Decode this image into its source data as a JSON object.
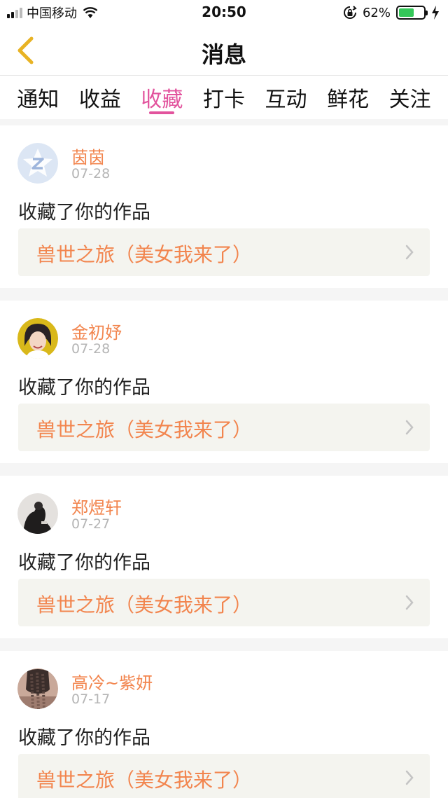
{
  "status_bar": {
    "carrier": "中国移动",
    "time": "20:50",
    "battery_percent": "62%",
    "battery_level": 0.62,
    "icons": [
      "signal-icon",
      "wifi-icon",
      "rotation-lock-icon",
      "battery-icon",
      "charging-icon"
    ]
  },
  "nav": {
    "title": "消息",
    "back_icon": "chevron-left-icon"
  },
  "tabs": [
    {
      "label": "通知",
      "active": false
    },
    {
      "label": "收益",
      "active": false
    },
    {
      "label": "收藏",
      "active": true
    },
    {
      "label": "打卡",
      "active": false
    },
    {
      "label": "互动",
      "active": false
    },
    {
      "label": "鲜花",
      "active": false
    },
    {
      "label": "关注",
      "active": false
    }
  ],
  "messages": [
    {
      "user": "茵茵",
      "date": "07-28",
      "text": "收藏了你的作品",
      "work": "兽世之旅（美女我来了）",
      "avatar": "default-avatar"
    },
    {
      "user": "金初妤",
      "date": "07-28",
      "text": "收藏了你的作品",
      "work": "兽世之旅（美女我来了）",
      "avatar": "user-avatar"
    },
    {
      "user": "郑煜轩",
      "date": "07-27",
      "text": "收藏了你的作品",
      "work": "兽世之旅（美女我来了）",
      "avatar": "user-avatar"
    },
    {
      "user": "高冷~紫妍",
      "date": "07-17",
      "text": "收藏了你的作品",
      "work": "兽世之旅（美女我来了）",
      "avatar": "user-avatar"
    }
  ],
  "colors": {
    "accent_pink": "#e2539d",
    "name_orange": "#f2854e",
    "back_yellow": "#e8b324",
    "date_gray": "#b5b5b5",
    "work_bg": "#f4f4ef"
  }
}
